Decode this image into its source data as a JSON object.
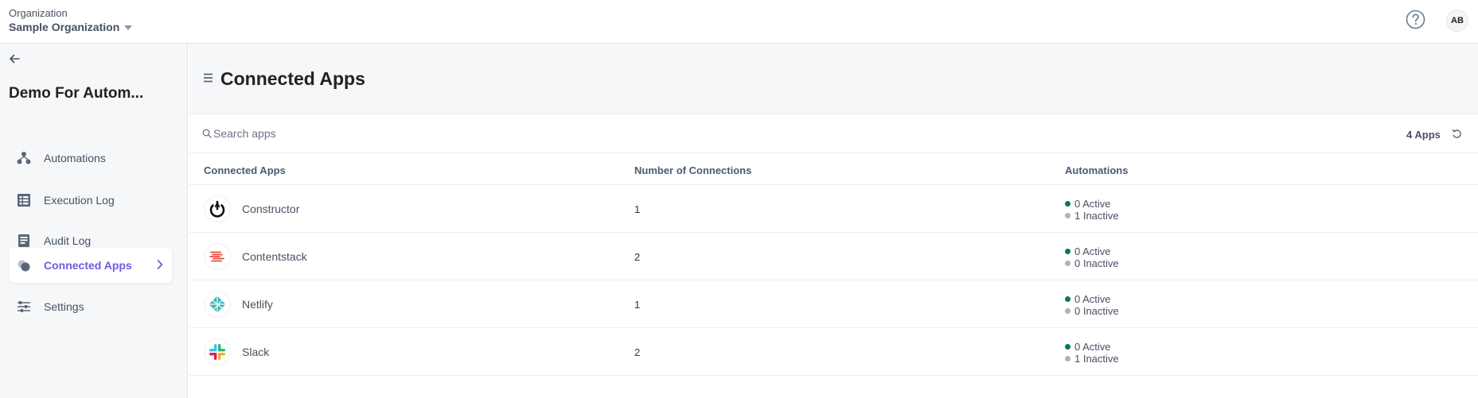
{
  "topbar": {
    "org_label": "Organization",
    "org_name": "Sample Organization",
    "avatar_initials": "AB"
  },
  "sidebar": {
    "project_title": "Demo For Autom...",
    "items": [
      {
        "label": "Automations",
        "icon": "automations-icon"
      },
      {
        "label": "Execution Log",
        "icon": "execution-log-icon"
      },
      {
        "label": "Audit Log",
        "icon": "audit-log-icon"
      },
      {
        "label": "Connected Apps",
        "icon": "connected-apps-icon",
        "active": true
      },
      {
        "label": "Settings",
        "icon": "settings-sliders-icon"
      }
    ]
  },
  "main": {
    "title": "Connected Apps",
    "search": {
      "placeholder": "Search apps",
      "value": ""
    },
    "app_count": "4 Apps",
    "columns": [
      "Connected Apps",
      "Number of Connections",
      "Automations"
    ],
    "rows": [
      {
        "name": "Constructor",
        "connections": "1",
        "active": "0 Active",
        "inactive": "1 Inactive",
        "logo": "constructor-logo"
      },
      {
        "name": "Contentstack",
        "connections": "2",
        "active": "0 Active",
        "inactive": "0 Inactive",
        "logo": "contentstack-logo"
      },
      {
        "name": "Netlify",
        "connections": "1",
        "active": "0 Active",
        "inactive": "0 Inactive",
        "logo": "netlify-logo"
      },
      {
        "name": "Slack",
        "connections": "2",
        "active": "0 Active",
        "inactive": "1 Inactive",
        "logo": "slack-logo"
      }
    ]
  },
  "colors": {
    "accent": "#6c5ce7",
    "active_dot": "#0a7a4a",
    "inactive_dot": "#a9b3c6",
    "text_muted": "#475161"
  }
}
